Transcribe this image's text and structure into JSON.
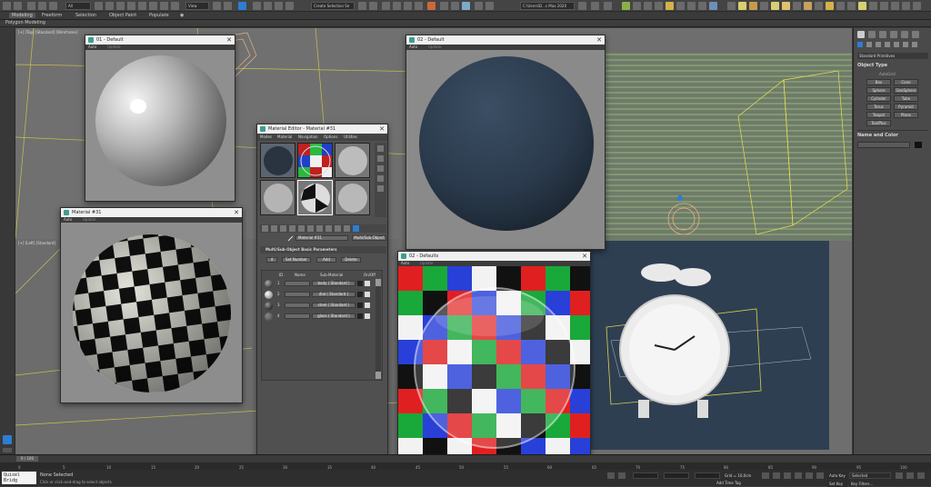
{
  "toolbar": {
    "layer_dropdown": "All",
    "view_dropdown": "View",
    "selection_set_placeholder": "Create Selection Se",
    "workspace": "Workspaces: Default",
    "project_path": "C:\\Users\\D...s Max 2020"
  },
  "ribbon": {
    "tabs": [
      "Modeling",
      "Freeform",
      "Selection",
      "Object Paint",
      "Populate"
    ],
    "subtitle": "Polygon Modeling"
  },
  "viewports": {
    "top_left_label": "[+] [Top] [Standard] [Wireframe]",
    "left_label": "[+] [Left] [Standard]"
  },
  "render_windows": {
    "sphere_default": {
      "title": "01 - Default",
      "mode": "Auto",
      "mode2": "Update"
    },
    "material_01": {
      "title": "Material #31",
      "mode": "Auto",
      "mode2": "Update"
    },
    "dark_default": {
      "title": "02 - Default",
      "mode": "Auto",
      "mode2": "Update"
    },
    "checker_default": {
      "title": "02 - Defaults",
      "mode": "Auto",
      "mode2": "Update"
    }
  },
  "material_editor": {
    "title": "Material Editor - Material #31",
    "menu": [
      "Modes",
      "Material",
      "Navigation",
      "Options",
      "Utilities"
    ],
    "material_name": "Material #31",
    "material_type": "Multi/Sub-Object",
    "rollout_title": "Multi/Sub-Object Basic Parameters",
    "count": "4",
    "set_number_label": "Set Number",
    "add_label": "Add",
    "delete_label": "Delete",
    "headers": [
      "ID",
      "Name",
      "Sub-Material",
      "On/Off"
    ],
    "rows": [
      {
        "id": "1",
        "name": "",
        "sub": "body  ( Standard )"
      },
      {
        "id": "2",
        "name": "",
        "sub": "dial  ( Standard )"
      },
      {
        "id": "3",
        "name": "",
        "sub": "steel  ( Standard )"
      },
      {
        "id": "4",
        "name": "",
        "sub": "glass  ( Standard )"
      }
    ]
  },
  "command_panel": {
    "category": "Standard Primitives",
    "rollout": "Object Type",
    "autogrid": "AutoGrid",
    "buttons": [
      "Box",
      "Cone",
      "Sphere",
      "GeoSphere",
      "Cylinder",
      "Tube",
      "Torus",
      "Pyramid",
      "Teapot",
      "Plane",
      "TextPlus"
    ],
    "name_color": "Name and Color"
  },
  "status": {
    "frame": "0 / 100",
    "selected": "None Selected",
    "hint": "Click or click-and-drag to select objects",
    "maxscript": "Quixel Bridg",
    "grid": "Grid = 10,0cm",
    "add_time_tag": "Add Time Tag",
    "auto_key": "Auto Key",
    "selected_dropdown": "Selected",
    "set_key": "Set Key",
    "key_filters": "Key Filters..."
  },
  "timeline_ticks": [
    "0",
    "5",
    "10",
    "15",
    "20",
    "25",
    "30",
    "35",
    "40",
    "45",
    "50",
    "55",
    "60",
    "65",
    "70",
    "75",
    "80",
    "85",
    "90",
    "95",
    "100"
  ],
  "colors": {
    "accent": "#2d7dd2",
    "viewport_bg": "#6e6e6e",
    "dark_vp": "#2f3f52"
  }
}
